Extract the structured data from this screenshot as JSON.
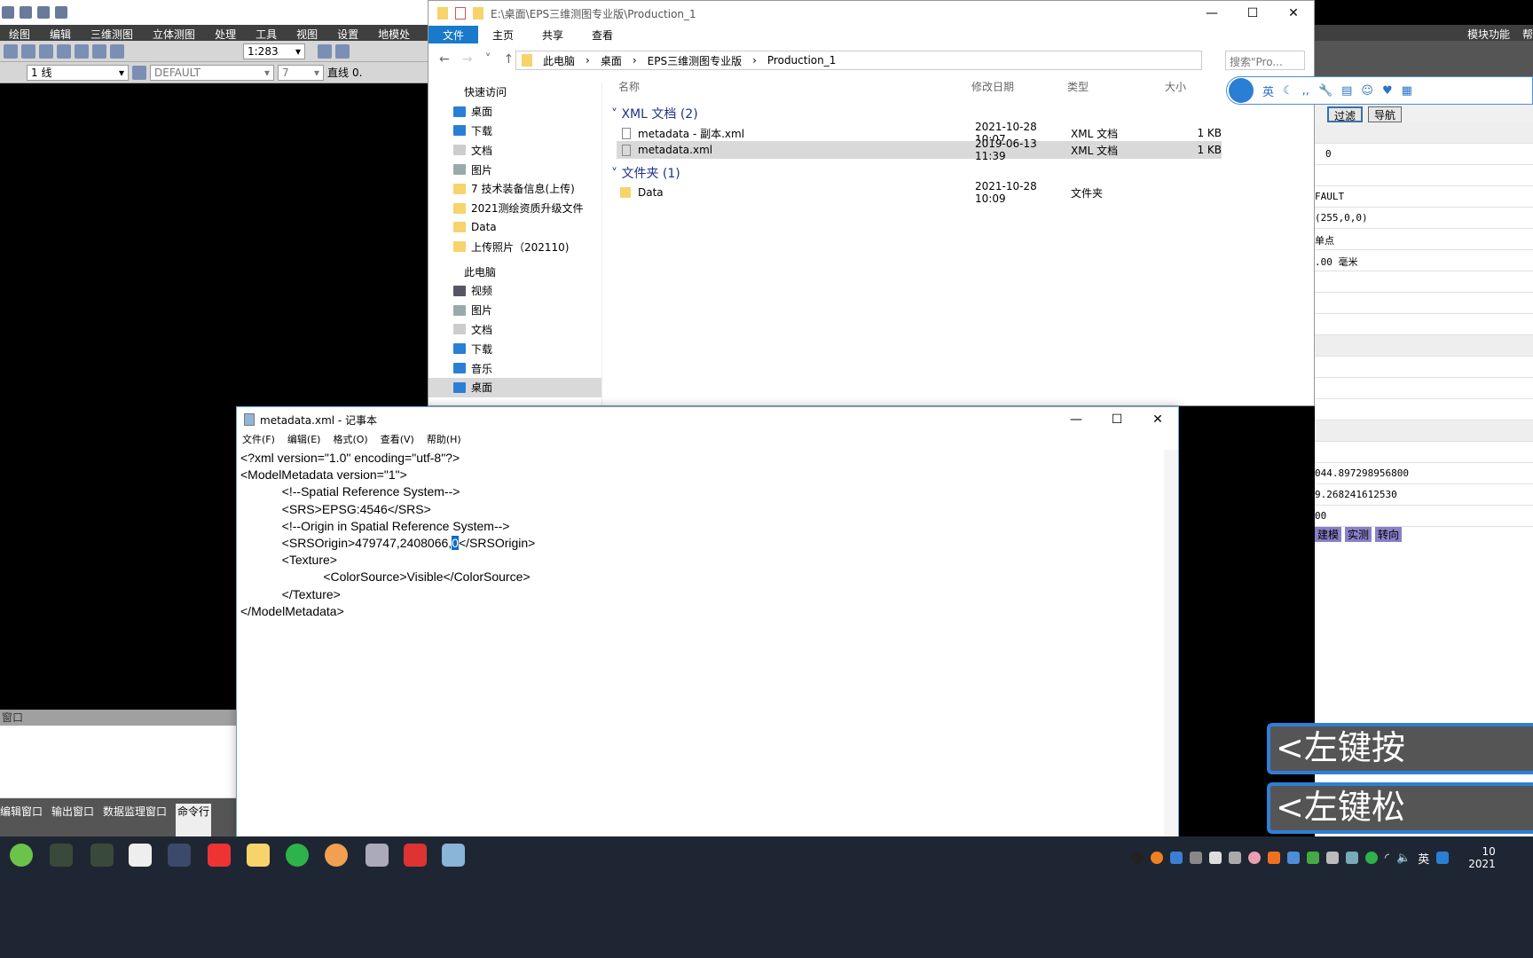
{
  "eps": {
    "menu": [
      "绘图",
      "编辑",
      "三维测图",
      "立体测图",
      "处理",
      "工具",
      "视图",
      "设置",
      "地模处"
    ],
    "scale": "1:283",
    "line_type": "1 线",
    "layer": "DEFAULT",
    "color_index": "7",
    "line_style": "直线",
    "line_width": "0.",
    "module_menu": "模块功能",
    "help_menu": "帮",
    "filter_btn": "过滤",
    "nav_btn": "导航",
    "props": [
      "0",
      "FAULT",
      "(255,0,0)",
      "单点",
      ".00 毫米"
    ],
    "coords": [
      "044.897298956800",
      "9.268241612530",
      "00"
    ],
    "mode_buttons": [
      "建模",
      "实测",
      "转向"
    ],
    "bottom_header": "窗口",
    "bottom_tabs": [
      "编辑窗口",
      "输出窗口",
      "数据监理窗口",
      "命令行"
    ]
  },
  "explorer": {
    "title_path": "E:\\桌面\\EPS三维测图专业版\\Production_1",
    "ribbon": [
      "文件",
      "主页",
      "共享",
      "查看"
    ],
    "breadcrumb": [
      "此电脑",
      "桌面",
      "EPS三维测图专业版",
      "Production_1"
    ],
    "search_placeholder": "搜索\"Pro...",
    "columns": [
      "名称",
      "修改日期",
      "类型",
      "大小"
    ],
    "nav": {
      "quick_access": "快速访问",
      "quick_items": [
        "桌面",
        "下载",
        "文档",
        "图片",
        "7  技术装备信息(上传)",
        "2021测绘资质升级文件",
        "Data",
        "上传照片（202110)"
      ],
      "this_pc": "此电脑",
      "pc_items": [
        "视频",
        "图片",
        "文档",
        "下载",
        "音乐",
        "桌面"
      ]
    },
    "groups": [
      {
        "label": "XML 文档 (2)",
        "files": [
          {
            "name": "metadata - 副本.xml",
            "date": "2021-10-28 10:07",
            "type": "XML 文档",
            "size": "1 KB"
          },
          {
            "name": "metadata.xml",
            "date": "2019-06-13 11:39",
            "type": "XML 文档",
            "size": "1 KB"
          }
        ]
      },
      {
        "label": "文件夹 (1)",
        "files": [
          {
            "name": "Data",
            "date": "2021-10-28 10:09",
            "type": "文件夹",
            "size": ""
          }
        ]
      }
    ]
  },
  "notepad": {
    "title": "metadata.xml - 记事本",
    "menu": [
      "文件(F)",
      "编辑(E)",
      "格式(O)",
      "查看(V)",
      "帮助(H)"
    ],
    "lines": [
      "<?xml version=\"1.0\" encoding=\"utf-8\"?>",
      "<ModelMetadata version=\"1\">",
      "            <!--Spatial Reference System-->",
      "            <SRS>EPSG:4546</SRS>",
      "            <!--Origin in Spatial Reference System-->"
    ],
    "origin_prefix": "            <SRSOrigin>479747,2408066,",
    "origin_selected": "0",
    "origin_suffix": "</SRSOrigin>",
    "lines_after": [
      "            <Texture>",
      "                        <ColorSource>Visible</ColorSource>",
      "            </Texture>",
      "</ModelMetadata>"
    ]
  },
  "ime": {
    "lang": "英"
  },
  "overlays": [
    "<左键按",
    "<左键松"
  ],
  "tray": {
    "lang": "英",
    "time": "10",
    "date": "2021"
  }
}
